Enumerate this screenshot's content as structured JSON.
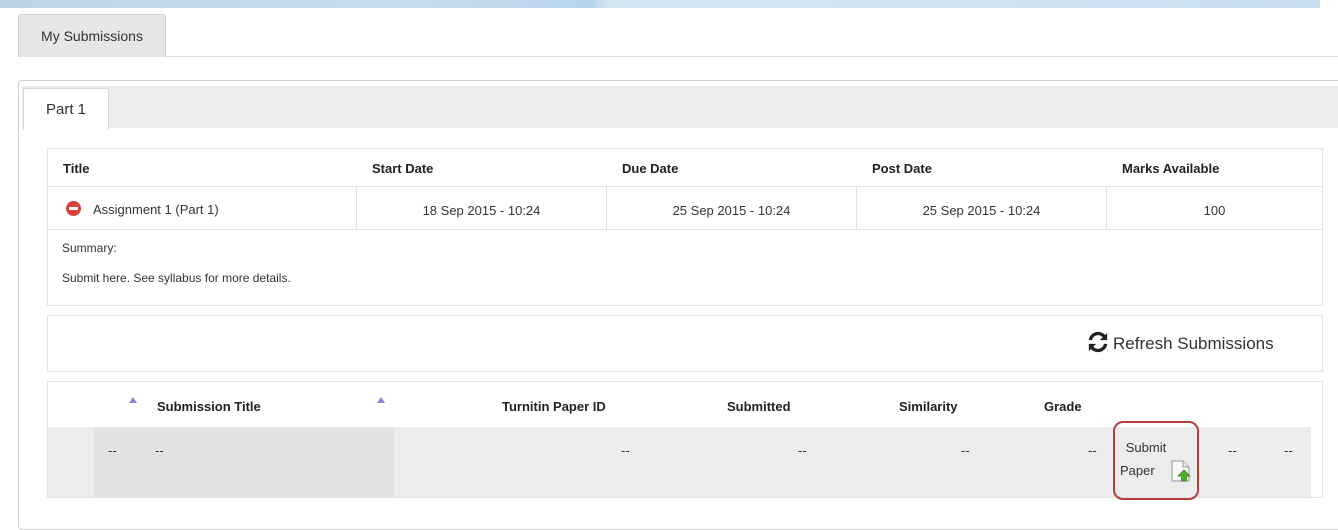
{
  "outer_tab": {
    "label": "My Submissions"
  },
  "inner_tab": {
    "label": "Part 1"
  },
  "assignment_table": {
    "headers": [
      "Title",
      "Start Date",
      "Due Date",
      "Post Date",
      "Marks Available"
    ],
    "row": {
      "title": "Assignment 1 (Part 1)",
      "start_date": "18 Sep 2015 - 10:24",
      "due_date": "25 Sep 2015 - 10:24",
      "post_date": "25 Sep 2015 - 10:24",
      "marks": "100"
    },
    "summary_label": "Summary:",
    "summary_text": "Submit here. See syllabus for more details."
  },
  "refresh": {
    "label": "Refresh Submissions"
  },
  "submissions_table": {
    "headers": [
      "Submission Title",
      "Turnitin Paper ID",
      "Submitted",
      "Similarity",
      "Grade"
    ],
    "row": {
      "col0": "--",
      "title": "--",
      "paper_id": "--",
      "submitted": "--",
      "similarity": "--",
      "grade": "--",
      "submit_line1": "Submit",
      "submit_line2": "Paper",
      "extra1": "--",
      "extra2": "--"
    }
  },
  "icons": {
    "status": "remove-circle-icon",
    "refresh": "refresh-icon",
    "sort": "sort-asc-icon",
    "upload": "file-upload-icon"
  },
  "colors": {
    "status_red": "#d9423a",
    "highlight_border": "#b3403a",
    "sort_arrow": "#8a86d6"
  }
}
